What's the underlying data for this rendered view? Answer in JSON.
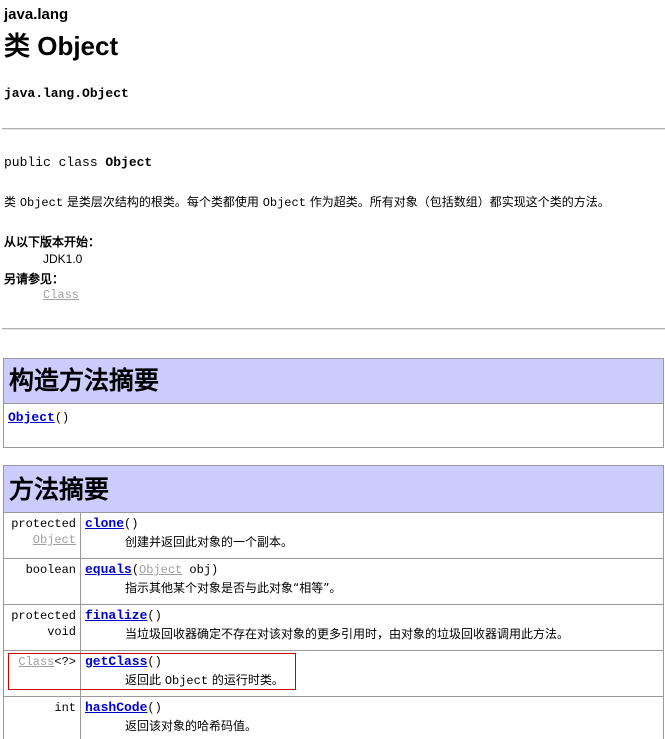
{
  "header": {
    "package": "java.lang",
    "title": "类 Object",
    "fqn": "java.lang.Object"
  },
  "declaration": {
    "prefix": "public class ",
    "name": "Object"
  },
  "description": {
    "p1": "类 ",
    "p1_code": "Object",
    "p2": " 是类层次结构的根类。每个类都使用 ",
    "p2_code": "Object",
    "p3": " 作为超类。所有对象（包括数组）都实现这个类的方法。"
  },
  "since": {
    "heading": "从以下版本开始：",
    "value": "JDK1.0"
  },
  "see_also": {
    "heading": "另请参见：",
    "link": "Class"
  },
  "constructor_summary": {
    "heading": "构造方法摘要",
    "name": "Object",
    "params": "()"
  },
  "method_summary": {
    "heading": "方法摘要",
    "rows": [
      {
        "mod1": "protected",
        "mod2": "Object",
        "name": "clone",
        "params": "()",
        "desc": "创建并返回此对象的一个副本。"
      },
      {
        "mod1": "boolean",
        "mod2": "",
        "name": "equals",
        "params_open": "(",
        "param_type": "Object",
        "params_rest": " obj)",
        "desc": "指示其他某个对象是否与此对象“相等”。"
      },
      {
        "mod1": "protected",
        "mod2": "void",
        "name": "finalize",
        "params": "()",
        "desc": "当垃圾回收器确定不存在对该对象的更多引用时，由对象的垃圾回收器调用此方法。"
      },
      {
        "mod_link": "Class",
        "mod_suffix": "<?>",
        "name": "getClass",
        "params": "()",
        "desc_pre": "返回此 ",
        "desc_code": "Object",
        "desc_post": " 的运行时类。"
      },
      {
        "mod1": "int",
        "name": "hashCode",
        "params": "()",
        "desc": "返回该对象的哈希码值。"
      }
    ]
  },
  "colors": {
    "section_header_bg": "#ccccff",
    "link": "#0000cc",
    "highlight_border": "#cc0000"
  }
}
